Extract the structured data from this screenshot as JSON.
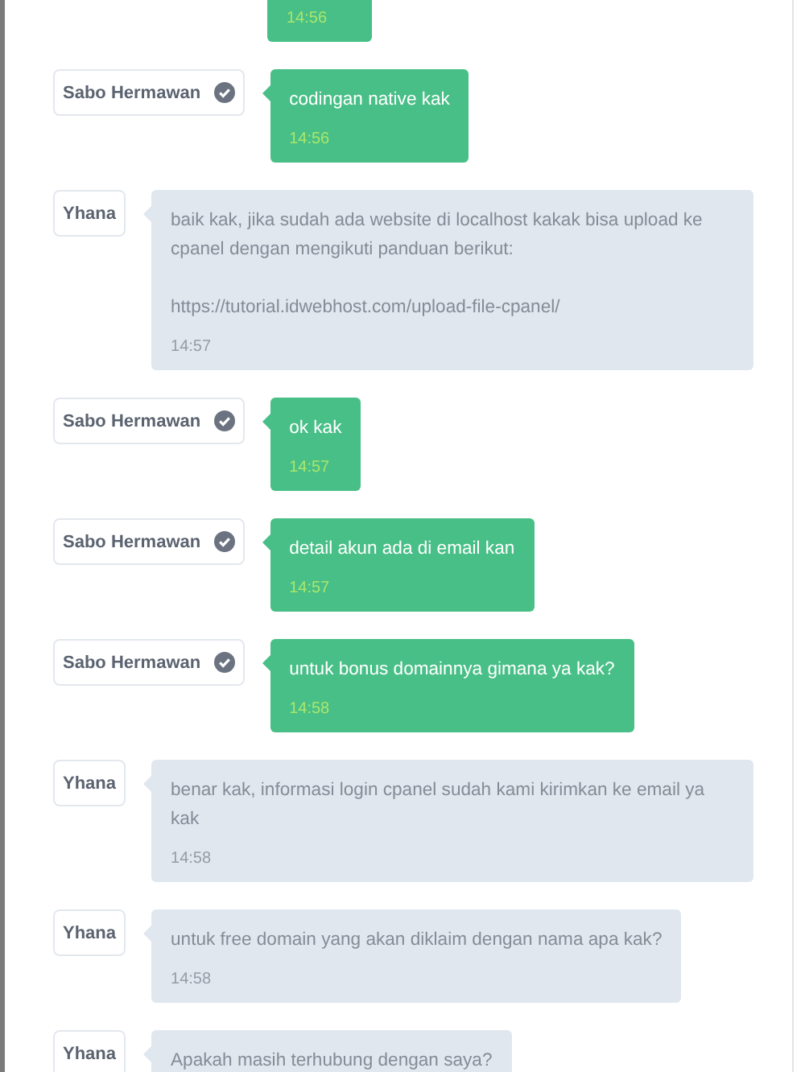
{
  "messages": [
    {
      "kind": "agent",
      "time": "14:56"
    },
    {
      "kind": "agent",
      "sender": "Sabo Hermawan",
      "verified": true,
      "text": "codingan native kak",
      "time": "14:56"
    },
    {
      "kind": "support",
      "sender": "Yhana",
      "verified": false,
      "text": "baik kak, jika sudah ada website di localhost kakak bisa upload ke cpanel dengan mengikuti panduan berikut:\n\nhttps://tutorial.idwebhost.com/upload-file-cpanel/",
      "time": "14:57"
    },
    {
      "kind": "agent",
      "sender": "Sabo Hermawan",
      "verified": true,
      "text": "ok kak",
      "time": "14:57"
    },
    {
      "kind": "agent",
      "sender": "Sabo Hermawan",
      "verified": true,
      "text": "detail akun ada di email kan",
      "time": "14:57"
    },
    {
      "kind": "agent",
      "sender": "Sabo Hermawan",
      "verified": true,
      "text": "untuk bonus domainnya gimana ya kak?",
      "time": "14:58"
    },
    {
      "kind": "support",
      "sender": "Yhana",
      "verified": false,
      "text": "benar kak, informasi login cpanel sudah kami kirimkan ke email ya kak",
      "time": "14:58"
    },
    {
      "kind": "support",
      "sender": "Yhana",
      "verified": false,
      "text": "untuk free domain yang akan diklaim dengan nama apa kak?",
      "time": "14:58"
    },
    {
      "kind": "support",
      "sender": "Yhana",
      "verified": false,
      "text": "Apakah masih terhubung dengan saya?"
    }
  ]
}
